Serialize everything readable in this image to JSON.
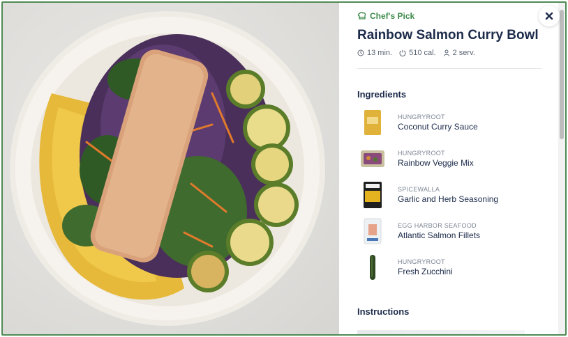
{
  "badge": {
    "icon": "chef-hat-icon",
    "label": "Chef's Pick"
  },
  "recipe": {
    "title": "Rainbow Salmon Curry Bowl",
    "time": "13 min.",
    "calories": "510 cal.",
    "servings": "2 serv."
  },
  "sections": {
    "ingredients": "Ingredients",
    "instructions": "Instructions"
  },
  "ingredients": [
    {
      "brand": "HUNGRYROOT",
      "name": "Coconut Curry Sauce",
      "thumb": "sauce-jar"
    },
    {
      "brand": "HUNGRYROOT",
      "name": "Rainbow Veggie Mix",
      "thumb": "veggie-pack"
    },
    {
      "brand": "SPICEWALLA",
      "name": "Garlic and Herb Seasoning",
      "thumb": "spice-tin"
    },
    {
      "brand": "EGG HARBOR SEAFOOD",
      "name": "Atlantic Salmon Fillets",
      "thumb": "fish-pack"
    },
    {
      "brand": "HUNGRYROOT",
      "name": "Fresh Zucchini",
      "thumb": "zucchini"
    }
  ],
  "colors": {
    "accent_green": "#3d8b4b",
    "title_navy": "#1c2b4a",
    "frame_green": "#4f8a55"
  }
}
